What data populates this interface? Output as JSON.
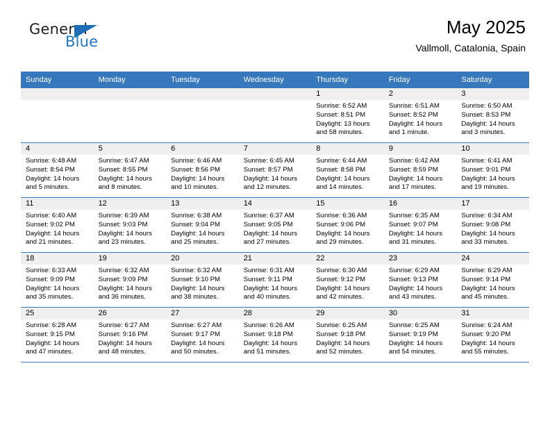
{
  "brand": {
    "word_one": "General",
    "word_two": "Blue",
    "logo_icon": "triangle-logo-icon"
  },
  "header": {
    "month_title": "May 2025",
    "location": "Vallmoll, Catalonia, Spain"
  },
  "calendar": {
    "weekday_headers": [
      "Sunday",
      "Monday",
      "Tuesday",
      "Wednesday",
      "Thursday",
      "Friday",
      "Saturday"
    ],
    "accent_color": "#3778bd",
    "daynum_band_color": "#efefef",
    "weeks": [
      [
        {
          "day": "",
          "sunrise": "",
          "sunset": "",
          "daylight_line1": "",
          "daylight_line2": ""
        },
        {
          "day": "",
          "sunrise": "",
          "sunset": "",
          "daylight_line1": "",
          "daylight_line2": ""
        },
        {
          "day": "",
          "sunrise": "",
          "sunset": "",
          "daylight_line1": "",
          "daylight_line2": ""
        },
        {
          "day": "",
          "sunrise": "",
          "sunset": "",
          "daylight_line1": "",
          "daylight_line2": ""
        },
        {
          "day": "1",
          "sunrise": "Sunrise: 6:52 AM",
          "sunset": "Sunset: 8:51 PM",
          "daylight_line1": "Daylight: 13 hours",
          "daylight_line2": "and 58 minutes."
        },
        {
          "day": "2",
          "sunrise": "Sunrise: 6:51 AM",
          "sunset": "Sunset: 8:52 PM",
          "daylight_line1": "Daylight: 14 hours",
          "daylight_line2": "and 1 minute."
        },
        {
          "day": "3",
          "sunrise": "Sunrise: 6:50 AM",
          "sunset": "Sunset: 8:53 PM",
          "daylight_line1": "Daylight: 14 hours",
          "daylight_line2": "and 3 minutes."
        }
      ],
      [
        {
          "day": "4",
          "sunrise": "Sunrise: 6:48 AM",
          "sunset": "Sunset: 8:54 PM",
          "daylight_line1": "Daylight: 14 hours",
          "daylight_line2": "and 5 minutes."
        },
        {
          "day": "5",
          "sunrise": "Sunrise: 6:47 AM",
          "sunset": "Sunset: 8:55 PM",
          "daylight_line1": "Daylight: 14 hours",
          "daylight_line2": "and 8 minutes."
        },
        {
          "day": "6",
          "sunrise": "Sunrise: 6:46 AM",
          "sunset": "Sunset: 8:56 PM",
          "daylight_line1": "Daylight: 14 hours",
          "daylight_line2": "and 10 minutes."
        },
        {
          "day": "7",
          "sunrise": "Sunrise: 6:45 AM",
          "sunset": "Sunset: 8:57 PM",
          "daylight_line1": "Daylight: 14 hours",
          "daylight_line2": "and 12 minutes."
        },
        {
          "day": "8",
          "sunrise": "Sunrise: 6:44 AM",
          "sunset": "Sunset: 8:58 PM",
          "daylight_line1": "Daylight: 14 hours",
          "daylight_line2": "and 14 minutes."
        },
        {
          "day": "9",
          "sunrise": "Sunrise: 6:42 AM",
          "sunset": "Sunset: 8:59 PM",
          "daylight_line1": "Daylight: 14 hours",
          "daylight_line2": "and 17 minutes."
        },
        {
          "day": "10",
          "sunrise": "Sunrise: 6:41 AM",
          "sunset": "Sunset: 9:01 PM",
          "daylight_line1": "Daylight: 14 hours",
          "daylight_line2": "and 19 minutes."
        }
      ],
      [
        {
          "day": "11",
          "sunrise": "Sunrise: 6:40 AM",
          "sunset": "Sunset: 9:02 PM",
          "daylight_line1": "Daylight: 14 hours",
          "daylight_line2": "and 21 minutes."
        },
        {
          "day": "12",
          "sunrise": "Sunrise: 6:39 AM",
          "sunset": "Sunset: 9:03 PM",
          "daylight_line1": "Daylight: 14 hours",
          "daylight_line2": "and 23 minutes."
        },
        {
          "day": "13",
          "sunrise": "Sunrise: 6:38 AM",
          "sunset": "Sunset: 9:04 PM",
          "daylight_line1": "Daylight: 14 hours",
          "daylight_line2": "and 25 minutes."
        },
        {
          "day": "14",
          "sunrise": "Sunrise: 6:37 AM",
          "sunset": "Sunset: 9:05 PM",
          "daylight_line1": "Daylight: 14 hours",
          "daylight_line2": "and 27 minutes."
        },
        {
          "day": "15",
          "sunrise": "Sunrise: 6:36 AM",
          "sunset": "Sunset: 9:06 PM",
          "daylight_line1": "Daylight: 14 hours",
          "daylight_line2": "and 29 minutes."
        },
        {
          "day": "16",
          "sunrise": "Sunrise: 6:35 AM",
          "sunset": "Sunset: 9:07 PM",
          "daylight_line1": "Daylight: 14 hours",
          "daylight_line2": "and 31 minutes."
        },
        {
          "day": "17",
          "sunrise": "Sunrise: 6:34 AM",
          "sunset": "Sunset: 9:08 PM",
          "daylight_line1": "Daylight: 14 hours",
          "daylight_line2": "and 33 minutes."
        }
      ],
      [
        {
          "day": "18",
          "sunrise": "Sunrise: 6:33 AM",
          "sunset": "Sunset: 9:09 PM",
          "daylight_line1": "Daylight: 14 hours",
          "daylight_line2": "and 35 minutes."
        },
        {
          "day": "19",
          "sunrise": "Sunrise: 6:32 AM",
          "sunset": "Sunset: 9:09 PM",
          "daylight_line1": "Daylight: 14 hours",
          "daylight_line2": "and 36 minutes."
        },
        {
          "day": "20",
          "sunrise": "Sunrise: 6:32 AM",
          "sunset": "Sunset: 9:10 PM",
          "daylight_line1": "Daylight: 14 hours",
          "daylight_line2": "and 38 minutes."
        },
        {
          "day": "21",
          "sunrise": "Sunrise: 6:31 AM",
          "sunset": "Sunset: 9:11 PM",
          "daylight_line1": "Daylight: 14 hours",
          "daylight_line2": "and 40 minutes."
        },
        {
          "day": "22",
          "sunrise": "Sunrise: 6:30 AM",
          "sunset": "Sunset: 9:12 PM",
          "daylight_line1": "Daylight: 14 hours",
          "daylight_line2": "and 42 minutes."
        },
        {
          "day": "23",
          "sunrise": "Sunrise: 6:29 AM",
          "sunset": "Sunset: 9:13 PM",
          "daylight_line1": "Daylight: 14 hours",
          "daylight_line2": "and 43 minutes."
        },
        {
          "day": "24",
          "sunrise": "Sunrise: 6:29 AM",
          "sunset": "Sunset: 9:14 PM",
          "daylight_line1": "Daylight: 14 hours",
          "daylight_line2": "and 45 minutes."
        }
      ],
      [
        {
          "day": "25",
          "sunrise": "Sunrise: 6:28 AM",
          "sunset": "Sunset: 9:15 PM",
          "daylight_line1": "Daylight: 14 hours",
          "daylight_line2": "and 47 minutes."
        },
        {
          "day": "26",
          "sunrise": "Sunrise: 6:27 AM",
          "sunset": "Sunset: 9:16 PM",
          "daylight_line1": "Daylight: 14 hours",
          "daylight_line2": "and 48 minutes."
        },
        {
          "day": "27",
          "sunrise": "Sunrise: 6:27 AM",
          "sunset": "Sunset: 9:17 PM",
          "daylight_line1": "Daylight: 14 hours",
          "daylight_line2": "and 50 minutes."
        },
        {
          "day": "28",
          "sunrise": "Sunrise: 6:26 AM",
          "sunset": "Sunset: 9:18 PM",
          "daylight_line1": "Daylight: 14 hours",
          "daylight_line2": "and 51 minutes."
        },
        {
          "day": "29",
          "sunrise": "Sunrise: 6:25 AM",
          "sunset": "Sunset: 9:18 PM",
          "daylight_line1": "Daylight: 14 hours",
          "daylight_line2": "and 52 minutes."
        },
        {
          "day": "30",
          "sunrise": "Sunrise: 6:25 AM",
          "sunset": "Sunset: 9:19 PM",
          "daylight_line1": "Daylight: 14 hours",
          "daylight_line2": "and 54 minutes."
        },
        {
          "day": "31",
          "sunrise": "Sunrise: 6:24 AM",
          "sunset": "Sunset: 9:20 PM",
          "daylight_line1": "Daylight: 14 hours",
          "daylight_line2": "and 55 minutes."
        }
      ]
    ]
  }
}
